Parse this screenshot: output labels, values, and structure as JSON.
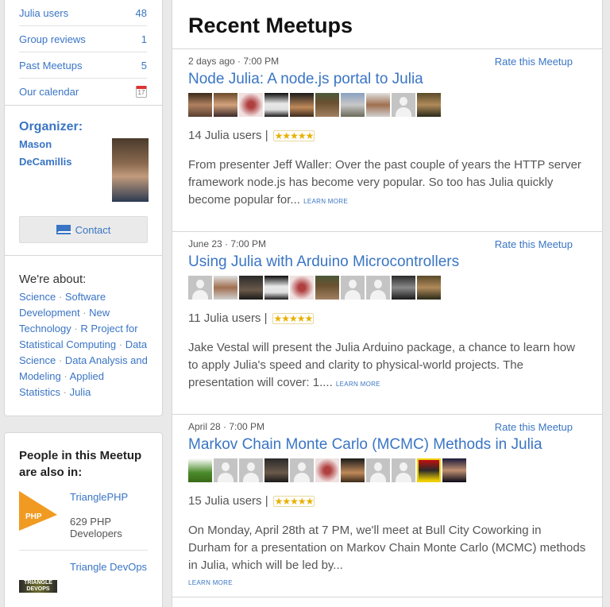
{
  "sidebar": {
    "stats": [
      {
        "label": "Julia users",
        "count": "48"
      },
      {
        "label": "Group reviews",
        "count": "1"
      },
      {
        "label": "Past Meetups",
        "count": "5"
      },
      {
        "label": "Our calendar",
        "icon": "calendar-icon",
        "icon_text": "17"
      }
    ],
    "organizer": {
      "heading": "Organizer:",
      "name": "Mason DeCamillis"
    },
    "contact_label": "Contact",
    "about": {
      "heading": "We're about:",
      "topics": [
        "Science",
        "Software Development",
        "New Technology",
        "R Project for Statistical Computing",
        "Data Science",
        "Data Analysis and Modeling",
        "Applied Statistics",
        "Julia"
      ]
    },
    "people": {
      "heading": "People in this Meetup are also in:",
      "groups": [
        {
          "name": "TrianglePHP",
          "members": "629 PHP Developers",
          "logo_text": "PHP"
        },
        {
          "name": "Triangle DevOps",
          "members": "",
          "logo_text": "TRIANGLE DEVOPS"
        }
      ]
    }
  },
  "main": {
    "title": "Recent Meetups",
    "rate_label": "Rate this Meetup",
    "learn_more": "LEARN MORE",
    "meetups": [
      {
        "date": "2 days ago · 7:00 PM",
        "title": "Node Julia: A node.js portal to Julia",
        "rsvp": "14 Julia users |",
        "stars": "★★★★★",
        "avatars": [
          "p1",
          "p2",
          "p3",
          "p4",
          "p5",
          "p6",
          "p7",
          "p8",
          "anon",
          "p9"
        ],
        "description": "From presenter Jeff Waller: Over the past couple of years the HTTP server framework node.js has become very popular. So too has Julia quickly become popular for..."
      },
      {
        "date": "June 23 · 7:00 PM",
        "title": "Using Julia with Arduino Microcontrollers",
        "rsvp": "11 Julia users |",
        "stars": "★★★★★",
        "avatars": [
          "anon",
          "p8",
          "p10",
          "p4",
          "p3",
          "p6",
          "anon",
          "anon",
          "p14",
          "p9"
        ],
        "description": "Jake Vestal will present the Julia Arduino package, a chance to learn how to apply Julia's speed and clarity to physical-world projects. The presentation will cover: 1...."
      },
      {
        "date": "April 28 · 7:00 PM",
        "title": "Markov Chain Monte Carlo (MCMC) Methods in Julia",
        "rsvp": "15 Julia users |",
        "stars": "★★★★★",
        "avatars": [
          "p11",
          "anon",
          "anon",
          "p10",
          "anon",
          "p3",
          "p5",
          "anon",
          "anon",
          "p12",
          "p13"
        ],
        "description": "On Monday, April 28th at 7 PM, we'll meet at Bull City Coworking in Durham for a presentation on Markov Chain Monte Carlo (MCMC) methods in Julia, which will be led by..."
      }
    ]
  }
}
